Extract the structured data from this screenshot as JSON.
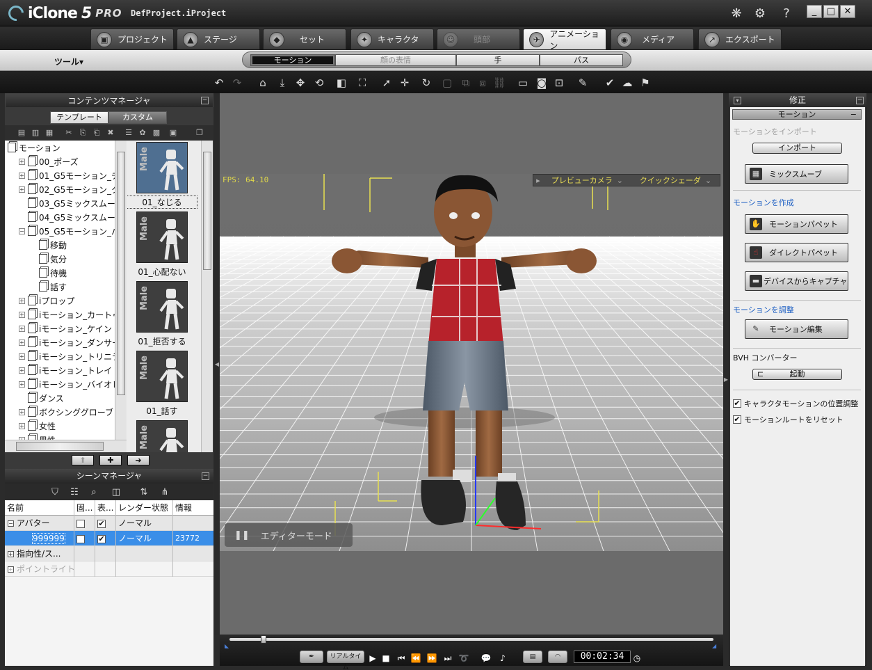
{
  "app": {
    "name": "iClone",
    "version_mark": "5",
    "edition": "PRO",
    "project": "DefProject.iProject"
  },
  "window": {
    "minimize": "_",
    "maximize": "□",
    "close": "✕",
    "help": "?"
  },
  "tabs": [
    {
      "label": "プロジェクト",
      "icon": "project-icon",
      "state": "normal"
    },
    {
      "label": "ステージ",
      "icon": "stage-icon",
      "state": "normal"
    },
    {
      "label": "セット",
      "icon": "set-icon",
      "state": "normal"
    },
    {
      "label": "キャラクタ",
      "icon": "character-icon",
      "state": "normal"
    },
    {
      "label": "頭部",
      "icon": "head-icon",
      "state": "disabled"
    },
    {
      "label": "アニメーション",
      "icon": "animation-icon",
      "state": "active"
    },
    {
      "label": "メディア",
      "icon": "media-icon",
      "state": "normal"
    },
    {
      "label": "エクスポート",
      "icon": "export-icon",
      "state": "normal"
    }
  ],
  "subbar": {
    "tools": "ツール▾",
    "segments": [
      {
        "label": "モーション",
        "state": "active"
      },
      {
        "label": "顔の表情",
        "state": "disabled"
      },
      {
        "label": "手",
        "state": "normal"
      },
      {
        "label": "パス",
        "state": "normal"
      }
    ]
  },
  "content_manager": {
    "title": "コンテンツマネージャ",
    "tab_template": "テンプレート",
    "tab_custom": "カスタム",
    "tree": [
      {
        "label": "モーション",
        "level": 0,
        "exp": ""
      },
      {
        "label": "00_ポーズ",
        "level": 1,
        "exp": "+"
      },
      {
        "label": "01_G5モーション_チ",
        "level": 1,
        "exp": "+"
      },
      {
        "label": "02_G5モーション_ク",
        "level": 1,
        "exp": "+"
      },
      {
        "label": "03_G5ミックスムーフ",
        "level": 1,
        "exp": ""
      },
      {
        "label": "04_G5ミックスムーフ",
        "level": 1,
        "exp": ""
      },
      {
        "label": "05_G5モーション_パ",
        "level": 1,
        "exp": "−"
      },
      {
        "label": "移動",
        "level": 2,
        "exp": ""
      },
      {
        "label": "気分",
        "level": 2,
        "exp": ""
      },
      {
        "label": "待機",
        "level": 2,
        "exp": ""
      },
      {
        "label": "話す",
        "level": 2,
        "exp": ""
      },
      {
        "label": "iプロップ",
        "level": 1,
        "exp": "+"
      },
      {
        "label": "iモーション_カートゥ",
        "level": 1,
        "exp": "+"
      },
      {
        "label": "iモーション_ケイン",
        "level": 1,
        "exp": "+"
      },
      {
        "label": "iモーション_ダンサー",
        "level": 1,
        "exp": "+"
      },
      {
        "label": "iモーション_トリニテ",
        "level": 1,
        "exp": "+"
      },
      {
        "label": "iモーション_トレイ",
        "level": 1,
        "exp": "+"
      },
      {
        "label": "iモーション_バイオレ",
        "level": 1,
        "exp": "+"
      },
      {
        "label": "ダンス",
        "level": 1,
        "exp": ""
      },
      {
        "label": "ボクシンググローブ",
        "level": 1,
        "exp": "+"
      },
      {
        "label": "女性",
        "level": 1,
        "exp": "+"
      },
      {
        "label": "男性",
        "level": 1,
        "exp": "+"
      }
    ],
    "thumbs": [
      {
        "label": "01_なじる",
        "selected": true
      },
      {
        "label": "01_心配ない",
        "selected": false
      },
      {
        "label": "01_拒否する",
        "selected": false
      },
      {
        "label": "01_話す",
        "selected": false
      },
      {
        "label": "",
        "selected": false
      }
    ],
    "thumb_badge": "Male",
    "nav": {
      "up": "⬆",
      "add": "✚",
      "right": "➜"
    }
  },
  "scene_manager": {
    "title": "シーンマネージャ",
    "columns": [
      "名前",
      "固...",
      "表...",
      "レンダー状態",
      "情報"
    ],
    "rows": [
      {
        "name": "アバター",
        "exp": "−",
        "lock": "",
        "show": "✔",
        "render": "ノーマル",
        "info": "",
        "selected": false,
        "dim": false
      },
      {
        "name": "999999",
        "exp": "",
        "lock": "",
        "show": "✔",
        "render": "ノーマル",
        "info": "23772",
        "selected": true,
        "dim": false
      },
      {
        "name": "指向性/ス...",
        "exp": "+",
        "lock": "",
        "show": "",
        "render": "",
        "info": "",
        "selected": false,
        "dim": false
      },
      {
        "name": "ポイントライト",
        "exp": "+",
        "lock": "",
        "show": "",
        "render": "",
        "info": "",
        "selected": false,
        "dim": true
      }
    ]
  },
  "viewport": {
    "fps": "FPS: 64.10",
    "camera": "プレビューカメラ",
    "shader": "クイックシェーダ",
    "editor_mode": "エディターモード",
    "pause": "❚❚"
  },
  "playback": {
    "realtime": "リアルタイム",
    "timecode": "00:02:34",
    "progress": 0.07
  },
  "modify": {
    "title": "修正",
    "section": "モーション",
    "import_label": "モーションをインポート",
    "import_btn": "インポート",
    "mix_btn": "ミックスムーブ",
    "create_label": "モーションを作成",
    "puppet_btn": "モーションパペット",
    "direct_btn": "ダイレクトパペット",
    "device_btn": "デバイスからキャプチャ",
    "adjust_label": "モーションを調整",
    "edit_btn": "モーション編集",
    "bvh_label": "BVH コンバーター",
    "launch_btn": "起動",
    "chk1": "キャラクタモーションの位置調整",
    "chk2": "モーションルートをリセット"
  }
}
